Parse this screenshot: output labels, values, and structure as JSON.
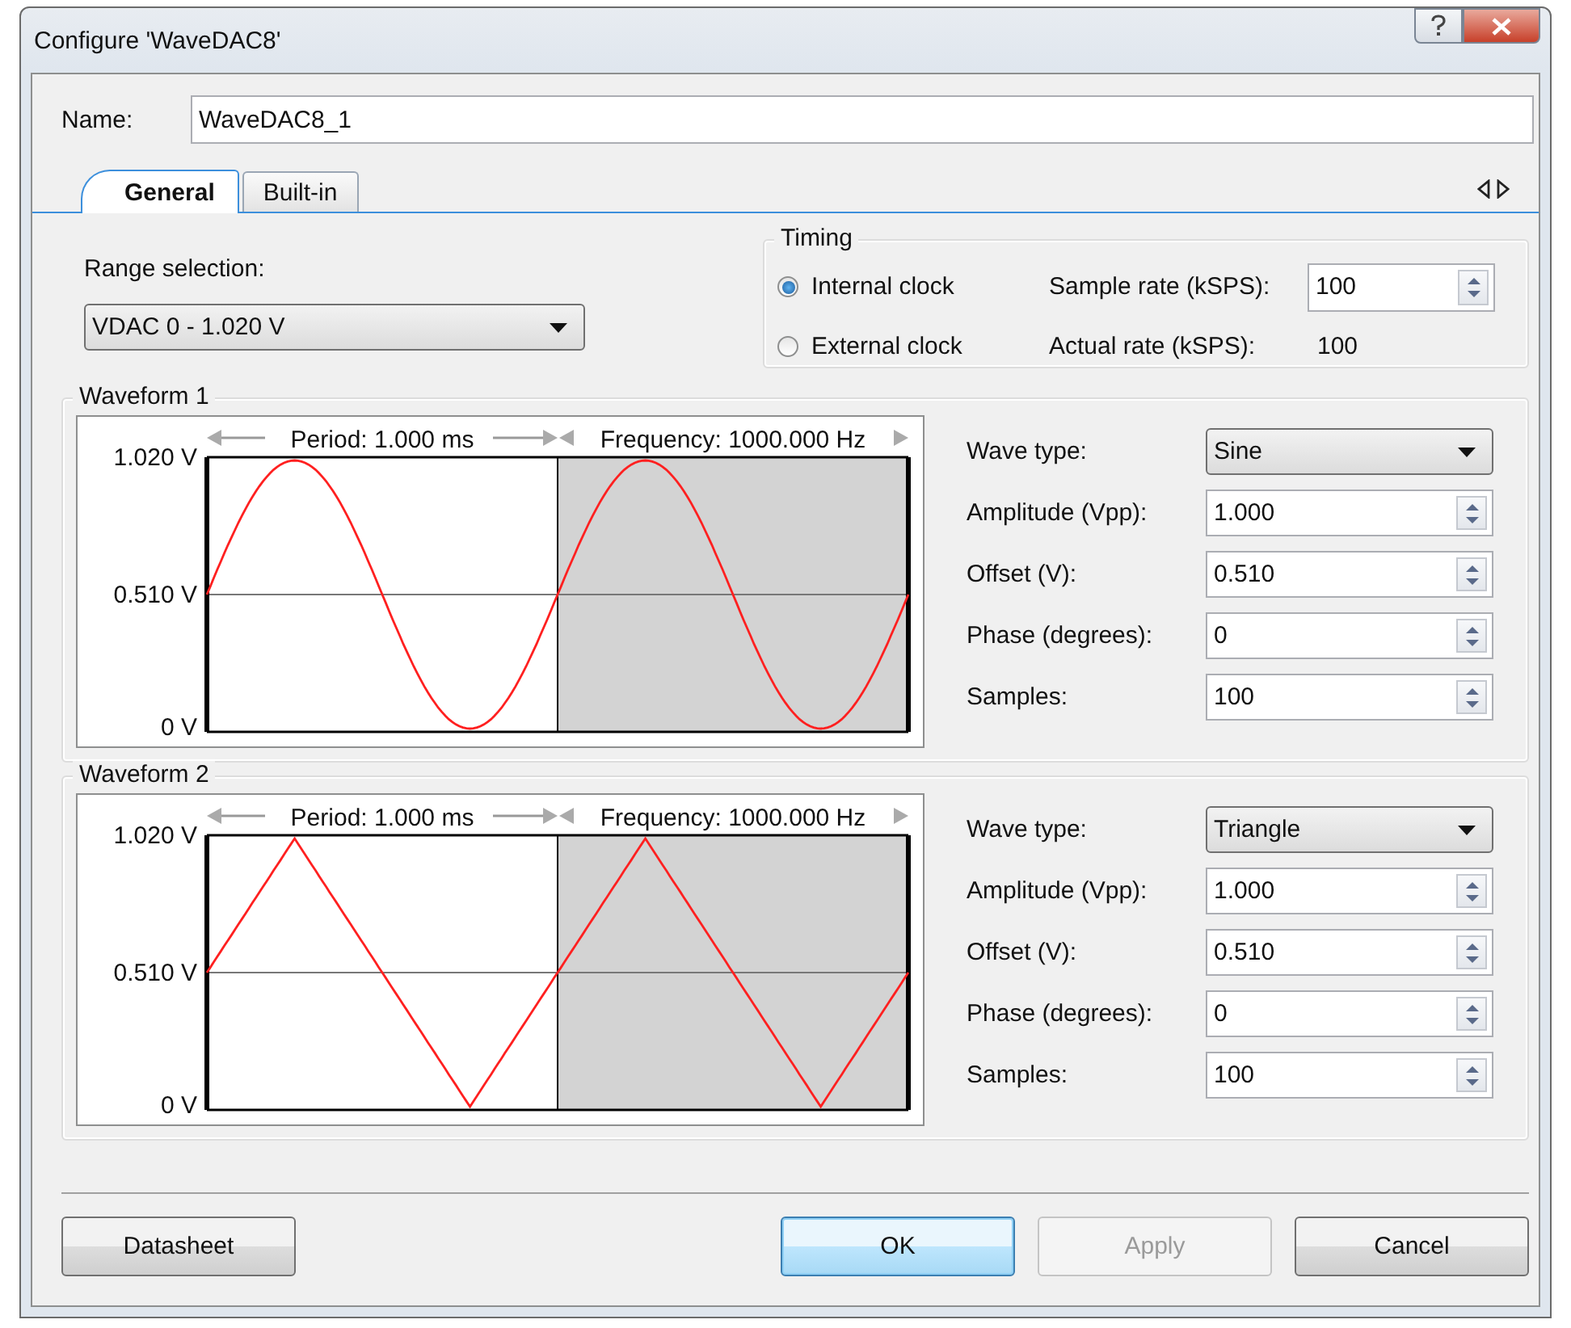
{
  "window": {
    "title": "Configure 'WaveDAC8'"
  },
  "name_field": {
    "label": "Name:",
    "value": "WaveDAC8_1"
  },
  "tabs": [
    {
      "label": "General",
      "selected": true
    },
    {
      "label": "Built-in",
      "selected": false
    }
  ],
  "range": {
    "label": "Range selection:",
    "value": "VDAC 0 - 1.020 V"
  },
  "timing": {
    "title": "Timing",
    "clock_options": [
      {
        "label": "Internal clock",
        "selected": true
      },
      {
        "label": "External clock",
        "selected": false
      }
    ],
    "sample_rate": {
      "label": "Sample rate (kSPS):",
      "value": "100"
    },
    "actual_rate": {
      "label": "Actual rate (kSPS):",
      "value": "100"
    }
  },
  "waveforms": [
    {
      "title": "Waveform 1",
      "kind": "sine",
      "period_label": "Period: 1.000 ms",
      "frequency_label": "Frequency: 1000.000 Hz",
      "y_labels": [
        "1.020 V",
        "0.510 V",
        "0 V"
      ],
      "settings": [
        {
          "kind": "dropdown",
          "label": "Wave type:",
          "value": "Sine"
        },
        {
          "kind": "spin",
          "label": "Amplitude (Vpp):",
          "value": "1.000"
        },
        {
          "kind": "spin",
          "label": "Offset (V):",
          "value": "0.510"
        },
        {
          "kind": "spin",
          "label": "Phase (degrees):",
          "value": "0"
        },
        {
          "kind": "spin",
          "label": "Samples:",
          "value": "100"
        }
      ]
    },
    {
      "title": "Waveform 2",
      "kind": "triangle",
      "period_label": "Period: 1.000 ms",
      "frequency_label": "Frequency: 1000.000 Hz",
      "y_labels": [
        "1.020 V",
        "0.510 V",
        "0 V"
      ],
      "settings": [
        {
          "kind": "dropdown",
          "label": "Wave type:",
          "value": "Triangle"
        },
        {
          "kind": "spin",
          "label": "Amplitude (Vpp):",
          "value": "1.000"
        },
        {
          "kind": "spin",
          "label": "Offset (V):",
          "value": "0.510"
        },
        {
          "kind": "spin",
          "label": "Phase (degrees):",
          "value": "0"
        },
        {
          "kind": "spin",
          "label": "Samples:",
          "value": "100"
        }
      ]
    }
  ],
  "buttons": [
    {
      "label": "Datasheet",
      "default": false,
      "disabled": false
    },
    {
      "label": "OK",
      "default": true,
      "disabled": false
    },
    {
      "label": "Apply",
      "default": false,
      "disabled": true
    },
    {
      "label": "Cancel",
      "default": false,
      "disabled": false
    }
  ]
}
